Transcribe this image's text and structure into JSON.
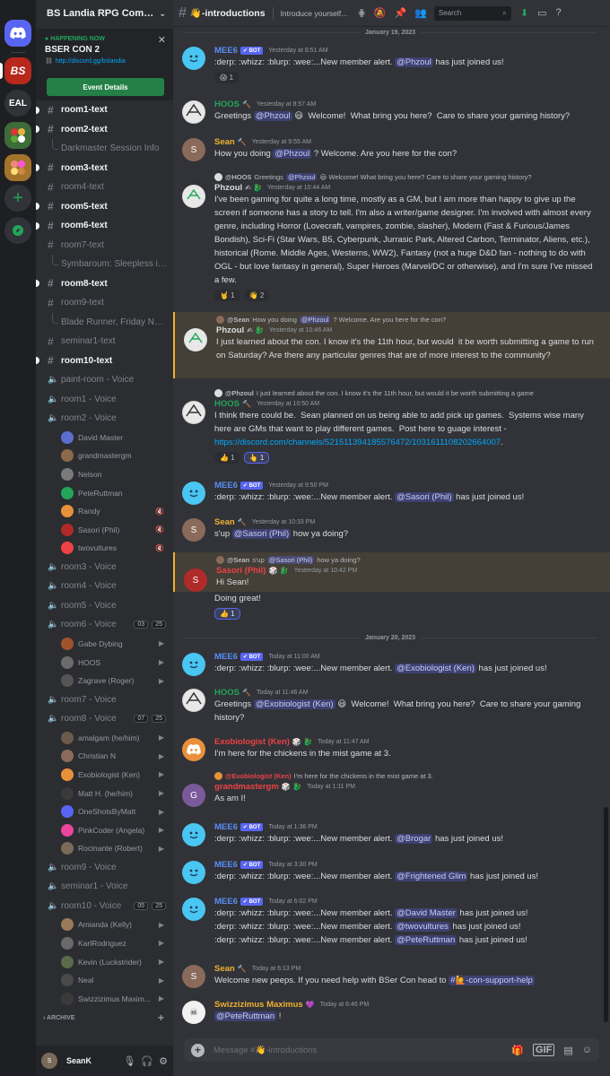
{
  "server": {
    "name": "BS Landia RPG Comm...",
    "rail": {
      "eal": "EAL",
      "bs": "BS"
    }
  },
  "event": {
    "happening": "HAPPENING NOW",
    "title": "BSER CON 2",
    "link": "http://discord.gg/bslandia",
    "button": "Event Details"
  },
  "channels": [
    {
      "type": "text",
      "name": "room1-text",
      "unread": true
    },
    {
      "type": "text",
      "name": "room2-text",
      "unread": true
    },
    {
      "type": "thread",
      "name": "Darkmaster Session Info"
    },
    {
      "type": "text",
      "name": "room3-text",
      "unread": true
    },
    {
      "type": "text",
      "name": "room4-text",
      "unread": false
    },
    {
      "type": "text",
      "name": "room5-text",
      "unread": true
    },
    {
      "type": "text",
      "name": "room6-text",
      "unread": true
    },
    {
      "type": "text",
      "name": "room7-text",
      "unread": false
    },
    {
      "type": "thread",
      "name": "Symbaroum: Sleepless in..."
    },
    {
      "type": "text",
      "name": "room8-text",
      "unread": true
    },
    {
      "type": "text",
      "name": "room9-text",
      "unread": false
    },
    {
      "type": "thread",
      "name": "Blade Runner, Friday Noon"
    },
    {
      "type": "text",
      "name": "seminar1-text",
      "unread": false
    },
    {
      "type": "text",
      "name": "room10-text",
      "unread": true
    },
    {
      "type": "voice",
      "name": "paint-room - Voice"
    },
    {
      "type": "voice",
      "name": "room1 - Voice"
    },
    {
      "type": "voice",
      "name": "room2 - Voice"
    },
    {
      "type": "user",
      "name": "David Master",
      "color": "#5b6fd1"
    },
    {
      "type": "user",
      "name": "grandmastergm",
      "color": "#8a6a4a"
    },
    {
      "type": "user",
      "name": "Nelson",
      "color": "#7a7a7a"
    },
    {
      "type": "user",
      "name": "PeteRuttman",
      "color": "#23a55a"
    },
    {
      "type": "user",
      "name": "Randy",
      "color": "#e8913a",
      "icon": "mute"
    },
    {
      "type": "user",
      "name": "Sasori (Phil)",
      "color": "#b02a2a",
      "icon": "mute"
    },
    {
      "type": "user",
      "name": "twovultures",
      "color": "#ed4245",
      "icon": "mute"
    },
    {
      "type": "voice",
      "name": "room3 - Voice"
    },
    {
      "type": "voice",
      "name": "room4 - Voice"
    },
    {
      "type": "voice",
      "name": "room5 - Voice"
    },
    {
      "type": "voice",
      "name": "room6 - Voice",
      "count": "03",
      "cap": "25"
    },
    {
      "type": "user",
      "name": "Gabe Dybing",
      "color": "#a0522d",
      "icon": "cam"
    },
    {
      "type": "user",
      "name": "HOOS",
      "color": "#6b6b6b",
      "icon": "cam"
    },
    {
      "type": "user",
      "name": "Zagrave (Roger)",
      "color": "#555555",
      "icon": "cam"
    },
    {
      "type": "voice",
      "name": "room7 - Voice"
    },
    {
      "type": "voice",
      "name": "room8 - Voice",
      "count": "07",
      "cap": "25"
    },
    {
      "type": "user",
      "name": "amalgam (he/him)",
      "color": "#6b5b4b",
      "icon": "cam"
    },
    {
      "type": "user",
      "name": "Christian N",
      "color": "#8b6b5b",
      "icon": "cam"
    },
    {
      "type": "user",
      "name": "Exobiologist (Ken)",
      "color": "#e8913a",
      "icon": "cam"
    },
    {
      "type": "user",
      "name": "Matt H. (he/him)",
      "color": "#3a3a3a",
      "icon": "cam"
    },
    {
      "type": "user",
      "name": "OneShotsByMatt",
      "color": "#5865f2",
      "icon": "cam"
    },
    {
      "type": "user",
      "name": "PinkCoder (Angela)",
      "color": "#eb459e",
      "icon": "cam"
    },
    {
      "type": "user",
      "name": "Rocinante (Robert)",
      "color": "#7a6a5a",
      "icon": "cam"
    },
    {
      "type": "voice",
      "name": "room9 - Voice"
    },
    {
      "type": "voice",
      "name": "seminar1 - Voice"
    },
    {
      "type": "voice",
      "name": "room10 - Voice",
      "count": "05",
      "cap": "25"
    },
    {
      "type": "user",
      "name": "Amianda (Kelly)",
      "color": "#9a7a5a",
      "icon": "cam"
    },
    {
      "type": "user",
      "name": "KarlRodriguez",
      "color": "#6a6a6a",
      "icon": "cam"
    },
    {
      "type": "user",
      "name": "Kevin (Luckstrider)",
      "color": "#5a6a4a",
      "icon": "cam"
    },
    {
      "type": "user",
      "name": "Neal",
      "color": "#4a4a4a",
      "icon": "cam"
    },
    {
      "type": "user",
      "name": "Swizzizimus Maxim...",
      "color": "#3a3a3a",
      "icon": "cam"
    }
  ],
  "archive": "ARCHIVE",
  "user": {
    "name": "SeanK"
  },
  "chat": {
    "channel": "👋-introductions",
    "topic": "Introduce yourself...",
    "search_placeholder": "Search",
    "composer_placeholder": "Message #👋-introductions"
  },
  "dates": [
    "January 19, 2023",
    "January 20, 2023"
  ],
  "colors": {
    "mee6": "#ffffff",
    "hoos": "#23a55a",
    "sean": "#f0b132",
    "sasori": "#ed4245",
    "exo": "#ed4245",
    "gm": "#ed4245",
    "swizz": "#f0b132"
  }
}
